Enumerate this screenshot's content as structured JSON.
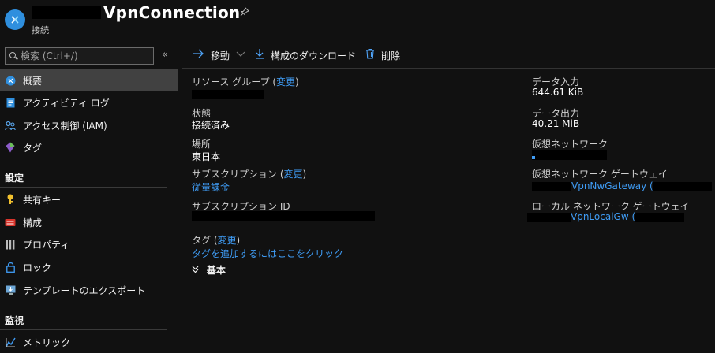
{
  "header": {
    "title": "VpnConnection",
    "subtitle": "接続"
  },
  "sidebar": {
    "search_placeholder": "検索 (Ctrl+/)",
    "items": [
      {
        "label": "概要"
      },
      {
        "label": "アクティビティ ログ"
      },
      {
        "label": "アクセス制御 (IAM)"
      },
      {
        "label": "タグ"
      }
    ],
    "section_settings": "設定",
    "settings_items": [
      {
        "label": "共有キー"
      },
      {
        "label": "構成"
      },
      {
        "label": "プロパティ"
      },
      {
        "label": "ロック"
      },
      {
        "label": "テンプレートのエクスポート"
      }
    ],
    "section_monitoring": "監視",
    "monitoring_items": [
      {
        "label": "メトリック"
      }
    ]
  },
  "toolbar": {
    "move": "移動",
    "download": "構成のダウンロード",
    "delete": "削除"
  },
  "essentials": {
    "resource_group_label": "リソース グループ",
    "change": "変更",
    "status_label": "状態",
    "status_value": "接続済み",
    "location_label": "場所",
    "location_value": "東日本",
    "subscription_label": "サブスクリプション",
    "subscription_value": "従量課金",
    "subscription_id_label": "サブスクリプション ID",
    "data_in_label": "データ入力",
    "data_in_value": "644.61 KiB",
    "data_out_label": "データ出力",
    "data_out_value": "40.21 MiB",
    "vnet_label": "仮想ネットワーク",
    "vnet_gw_label": "仮想ネットワーク ゲートウェイ",
    "vnet_gw_value": "VpnNwGateway",
    "local_gw_label": "ローカル ネットワーク ゲートウェイ",
    "local_gw_value": "VpnLocalGw",
    "tags_label": "タグ",
    "tags_add": "タグを追加するにはここをクリック",
    "essentials_toggle": "基本"
  }
}
